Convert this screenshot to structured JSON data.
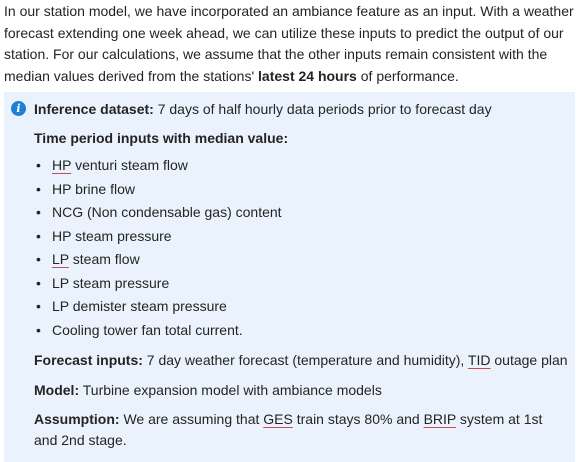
{
  "intro": {
    "part1": "In our station model, we have incorporated an ambiance feature as an input. With a weather forecast extending one week ahead, we can utilize these inputs to predict the output of our station. For our calculations, we assume that the other inputs remain consistent with the median values derived from the stations' ",
    "bold": "latest 24 hours",
    "part2": " of performance."
  },
  "infobox": {
    "icon": "info-icon",
    "inference_label": "Inference dataset:",
    "inference_text": " 7 days of half hourly data periods prior to forecast day",
    "time_period_heading": "Time period inputs with median value:",
    "items": [
      {
        "u": "HP",
        "rest": " venturi steam flow"
      },
      {
        "u": "",
        "rest": "HP brine flow"
      },
      {
        "u": "",
        "rest": "NCG  (Non condensable gas) content"
      },
      {
        "u": "",
        "rest": "HP steam pressure"
      },
      {
        "u": "LP",
        "rest": " steam flow"
      },
      {
        "u": "",
        "rest": "LP steam pressure"
      },
      {
        "u": "",
        "rest": "LP demister steam pressure"
      },
      {
        "u": "",
        "rest": "Cooling tower fan total current."
      }
    ],
    "forecast_label": "Forecast inputs:",
    "forecast_text_a": " 7 day weather forecast (temperature and humidity), ",
    "forecast_tid": "TID",
    "forecast_text_b": " outage plan",
    "model_label": "Model:",
    "model_text": " Turbine expansion model with ambiance models",
    "assumption_label": "Assumption:",
    "assumption_text_a": " We are assuming that ",
    "assumption_ges": "GES",
    "assumption_text_b": " train stays 80% and ",
    "assumption_brip": "BRIP",
    "assumption_text_c": " system at 1st and 2nd stage."
  }
}
